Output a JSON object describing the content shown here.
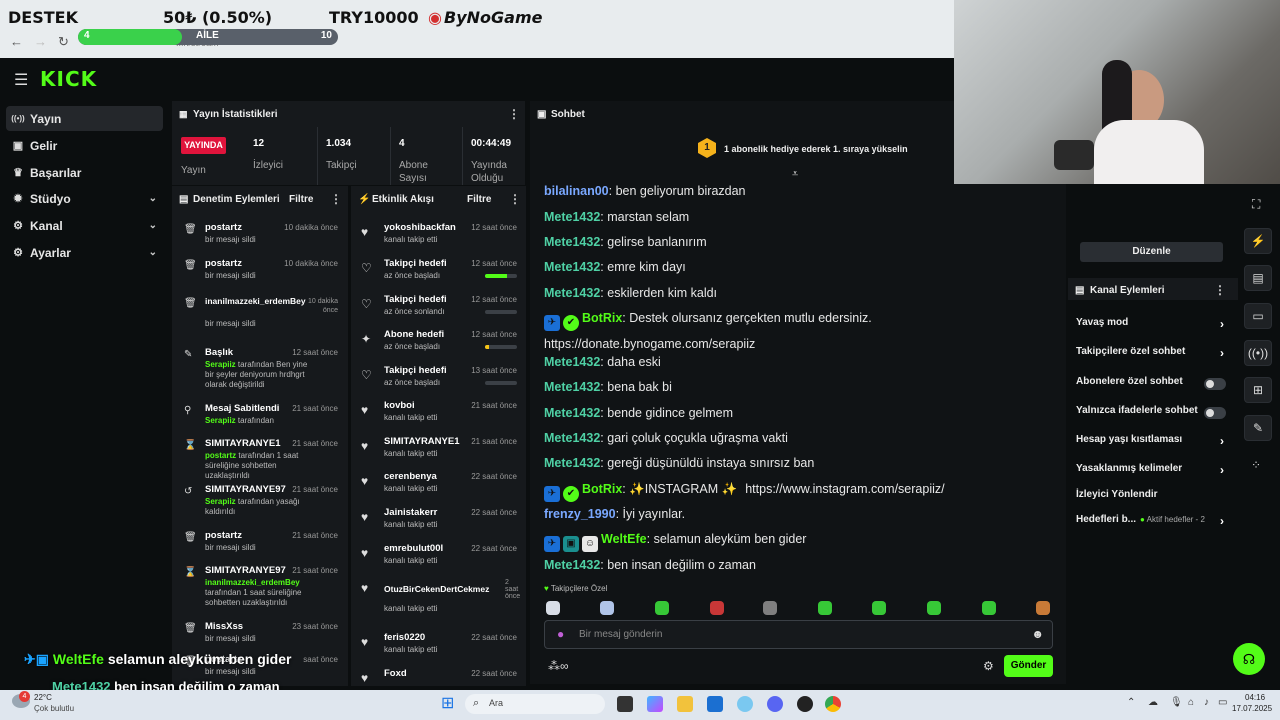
{
  "overlay": {
    "destek": "DESTEK",
    "amount": "50₺ (0.50%)",
    "goal": "TRY10000",
    "sponsor": "ByNoGame",
    "aile_label": "AİLE",
    "aile_current": "4",
    "aile_target": "10",
    "aile_progress": 0.4,
    "url_fragment": "...n/stream"
  },
  "nav": {
    "items": [
      {
        "label": "Yayın",
        "icon": "broadcast-icon"
      },
      {
        "label": "Gelir",
        "icon": "dollar-icon"
      },
      {
        "label": "Başarılar",
        "icon": "trophy-icon"
      },
      {
        "label": "Stüdyo",
        "icon": "palette-icon"
      },
      {
        "label": "Kanal",
        "icon": "gear-icon"
      },
      {
        "label": "Ayarlar",
        "icon": "gear-icon"
      }
    ]
  },
  "stats": {
    "title": "Yayın İstatistikleri",
    "live_badge": "YAYINDA",
    "live_label": "Yayın",
    "viewers_value": "12",
    "viewers_label": "İzleyici",
    "followers_value": "1.034",
    "followers_label": "Takipçi",
    "subs_value": "4",
    "subs_label": "Abone Sayısı",
    "uptime_value": "00:44:49",
    "uptime_label": "Yayında Olduğu"
  },
  "modlog": {
    "title": "Denetim Eylemleri",
    "filter": "Filtre",
    "items": [
      {
        "name": "postartz",
        "sub": "bir mesajı sildi",
        "time": "10 dakika önce"
      },
      {
        "name": "postartz",
        "sub": "bir mesajı sildi",
        "time": "10 dakika önce"
      },
      {
        "name": "inanilmazzeki_erdemBey",
        "sub": "bir mesajı sildi",
        "time": "10 dakika önce"
      },
      {
        "name": "Başlık",
        "hl": "Serapiiz",
        "sub": " tarafından Ben yine bir şeyler deniyorum hrdhgrt olarak değiştirildi",
        "time": "12 saat önce"
      },
      {
        "name": "Mesaj Sabitlendi",
        "hl": "Serapiiz",
        "sub": " tarafından",
        "time": "21 saat önce"
      },
      {
        "name": "SIMITAYRANYE1",
        "hl": "postartz",
        "sub": " tarafından 1 saat süreliğine sohbetten uzaklaştırıldı",
        "time": "21 saat önce"
      },
      {
        "name": "SIMITAYRANYE97",
        "hl": "Serapiiz",
        "sub": " tarafından yasağı kaldırıldı",
        "time": "21 saat önce"
      },
      {
        "name": "postartz",
        "sub": "bir mesajı sildi",
        "time": "21 saat önce"
      },
      {
        "name": "SIMITAYRANYE97",
        "hl": "inanilmazzeki_erdemBey",
        "sub": " tarafından 1 saat süreliğine sohbetten uzaklaştırıldı",
        "time": "21 saat önce"
      },
      {
        "name": "MissXss",
        "sub": "bir mesajı sildi",
        "time": "23 saat önce"
      },
      {
        "name": "postartz",
        "sub": "bir mesajı sildi",
        "time": "saat önce"
      }
    ]
  },
  "activity": {
    "title": "Etkinlik Akışı",
    "items": [
      {
        "name": "yokoshibackfan",
        "sub": "kanalı takip etti",
        "time": "12 saat önce"
      },
      {
        "name": "Takipçi hedefi",
        "sub": "az önce başladı",
        "time": "12 saat önce",
        "progress": 0.7,
        "bar_color": "#53fc18"
      },
      {
        "name": "Takipçi hedefi",
        "sub": "az önce sonlandı",
        "time": "12 saat önce",
        "progress": 0,
        "bar_color": "#53fc18"
      },
      {
        "name": "Abone hedefi",
        "sub": "az önce başladı",
        "time": "12 saat önce",
        "progress": 0.12,
        "bar_color": "#f5c518"
      },
      {
        "name": "Takipçi hedefi",
        "sub": "az önce başladı",
        "time": "13 saat önce",
        "progress": 0,
        "bar_color": "#53fc18"
      },
      {
        "name": "kovboi",
        "sub": "kanalı takip etti",
        "time": "21 saat önce"
      },
      {
        "name": "SIMITAYRANYE1",
        "sub": "kanalı takip etti",
        "time": "21 saat önce"
      },
      {
        "name": "cerenbenya",
        "sub": "kanalı takip etti",
        "time": "22 saat önce"
      },
      {
        "name": "Jainistakerr",
        "sub": "kanalı takip etti",
        "time": "22 saat önce"
      },
      {
        "name": "emrebulut00I",
        "sub": "kanalı takip etti",
        "time": "22 saat önce"
      },
      {
        "name": "OtuzBirCekenDertCekmez",
        "sub": "kanalı takip etti",
        "time": "2 saat önce"
      },
      {
        "name": "feris0220",
        "sub": "kanalı takip etti",
        "time": "22 saat önce"
      },
      {
        "name": "Foxd",
        "sub": "",
        "time": "22 saat önce"
      }
    ]
  },
  "chat": {
    "title": "Sohbet",
    "pinned": "1 abonelik hediye ederek 1. sıraya yükselin",
    "pinned_rank": "1",
    "messages": [
      {
        "user": "bilalinan00",
        "color": "#7aa8ff",
        "text": "ben geliyorum birazdan"
      },
      {
        "user": "Mete1432",
        "color": "#4fd1a5",
        "text": "marstan selam"
      },
      {
        "user": "Mete1432",
        "color": "#4fd1a5",
        "text": "gelirse banlanırım"
      },
      {
        "user": "Mete1432",
        "color": "#4fd1a5",
        "text": "emre kim dayı"
      },
      {
        "user": "Mete1432",
        "color": "#4fd1a5",
        "text": "eskilerden kim kaldı"
      },
      {
        "user": "BotRix",
        "color": "#53fc18",
        "text": "Destek olursanız gerçekten mutlu edersiniz.",
        "link": "https://donate.bynogame.com/serapiiz",
        "badges": 2
      },
      {
        "user": "Mete1432",
        "color": "#4fd1a5",
        "text": "daha eski"
      },
      {
        "user": "Mete1432",
        "color": "#4fd1a5",
        "text": "bena bak bi"
      },
      {
        "user": "Mete1432",
        "color": "#4fd1a5",
        "text": "bende gidince gelmem"
      },
      {
        "user": "Mete1432",
        "color": "#4fd1a5",
        "text": "gari çoluk çoçukla uğraşma vakti"
      },
      {
        "user": "Mete1432",
        "color": "#4fd1a5",
        "text": "gereği düşünüldü instaya sınırsız ban"
      },
      {
        "user": "BotRix",
        "color": "#53fc18",
        "text": "✨INSTAGRAM ✨",
        "link": "https://www.instagram.com/serapiiz/",
        "badges": 2
      },
      {
        "user": "frenzy_1990",
        "color": "#7aa8ff",
        "text": "İyi yayınlar."
      },
      {
        "user": "WeltEfe",
        "color": "#53fc18",
        "text": "selamun aleyküm ben gider",
        "badges": 3
      },
      {
        "user": "Mete1432",
        "color": "#4fd1a5",
        "text": "ben insan değilim o zaman"
      }
    ],
    "followers_only": "Takipçilere Özel",
    "input_placeholder": "Bir mesaj gönderin",
    "send": "Gönder"
  },
  "right": {
    "edit": "Düzenle",
    "actions_title": "Kanal Eylemleri",
    "actions": [
      {
        "label": "Yavaş mod",
        "kind": "chevron"
      },
      {
        "label": "Takipçilere özel sohbet",
        "kind": "chevron"
      },
      {
        "label": "Abonelere özel sohbet",
        "kind": "toggle"
      },
      {
        "label": "Yalnızca ifadelerle sohbet",
        "kind": "toggle"
      },
      {
        "label": "Hesap yaşı kısıtlaması",
        "kind": "chevron"
      },
      {
        "label": "Yasaklanmış kelimeler",
        "kind": "chevron"
      },
      {
        "label": "İzleyici Yönlendir",
        "kind": "none"
      },
      {
        "label": "Hedefleri b...",
        "kind": "chevron",
        "extra": "Aktif hedefler - 2"
      }
    ]
  },
  "captions": {
    "line1_user": "WeltEfe",
    "line1_text": "selamun aleyküm ben gider",
    "line2_user": "Mete1432",
    "line2_text": "ben insan değilim o zaman"
  },
  "taskbar": {
    "weather_temp": "22°C",
    "weather_desc": "Çok bulutlu",
    "notif": "4",
    "search": "Ara",
    "time": "04:16",
    "date": "17.07.2025"
  },
  "colors": {
    "accent": "#53fc18",
    "bg": "#0b0e0f",
    "panel": "#16191c"
  }
}
